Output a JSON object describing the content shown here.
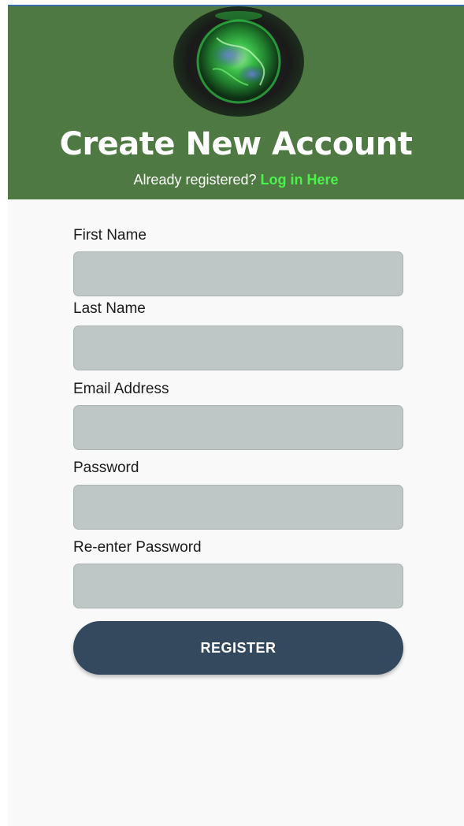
{
  "header": {
    "title": "Create New Account",
    "prompt": "Already registered?",
    "login_link": "Log in Here",
    "logo_icon": "globe-logo-icon"
  },
  "form": {
    "fields": [
      {
        "label": "First Name",
        "value": ""
      },
      {
        "label": "Last Name",
        "value": ""
      },
      {
        "label": "Email Address",
        "value": ""
      },
      {
        "label": "Password",
        "value": ""
      },
      {
        "label": "Re-enter Password",
        "value": ""
      }
    ],
    "submit_label": "REGISTER"
  },
  "colors": {
    "header_bg": "#4f7942",
    "link": "#4cf24c",
    "input_bg": "#bec6c6",
    "button_bg": "#34495e",
    "page_bg": "#f9f9f9"
  }
}
